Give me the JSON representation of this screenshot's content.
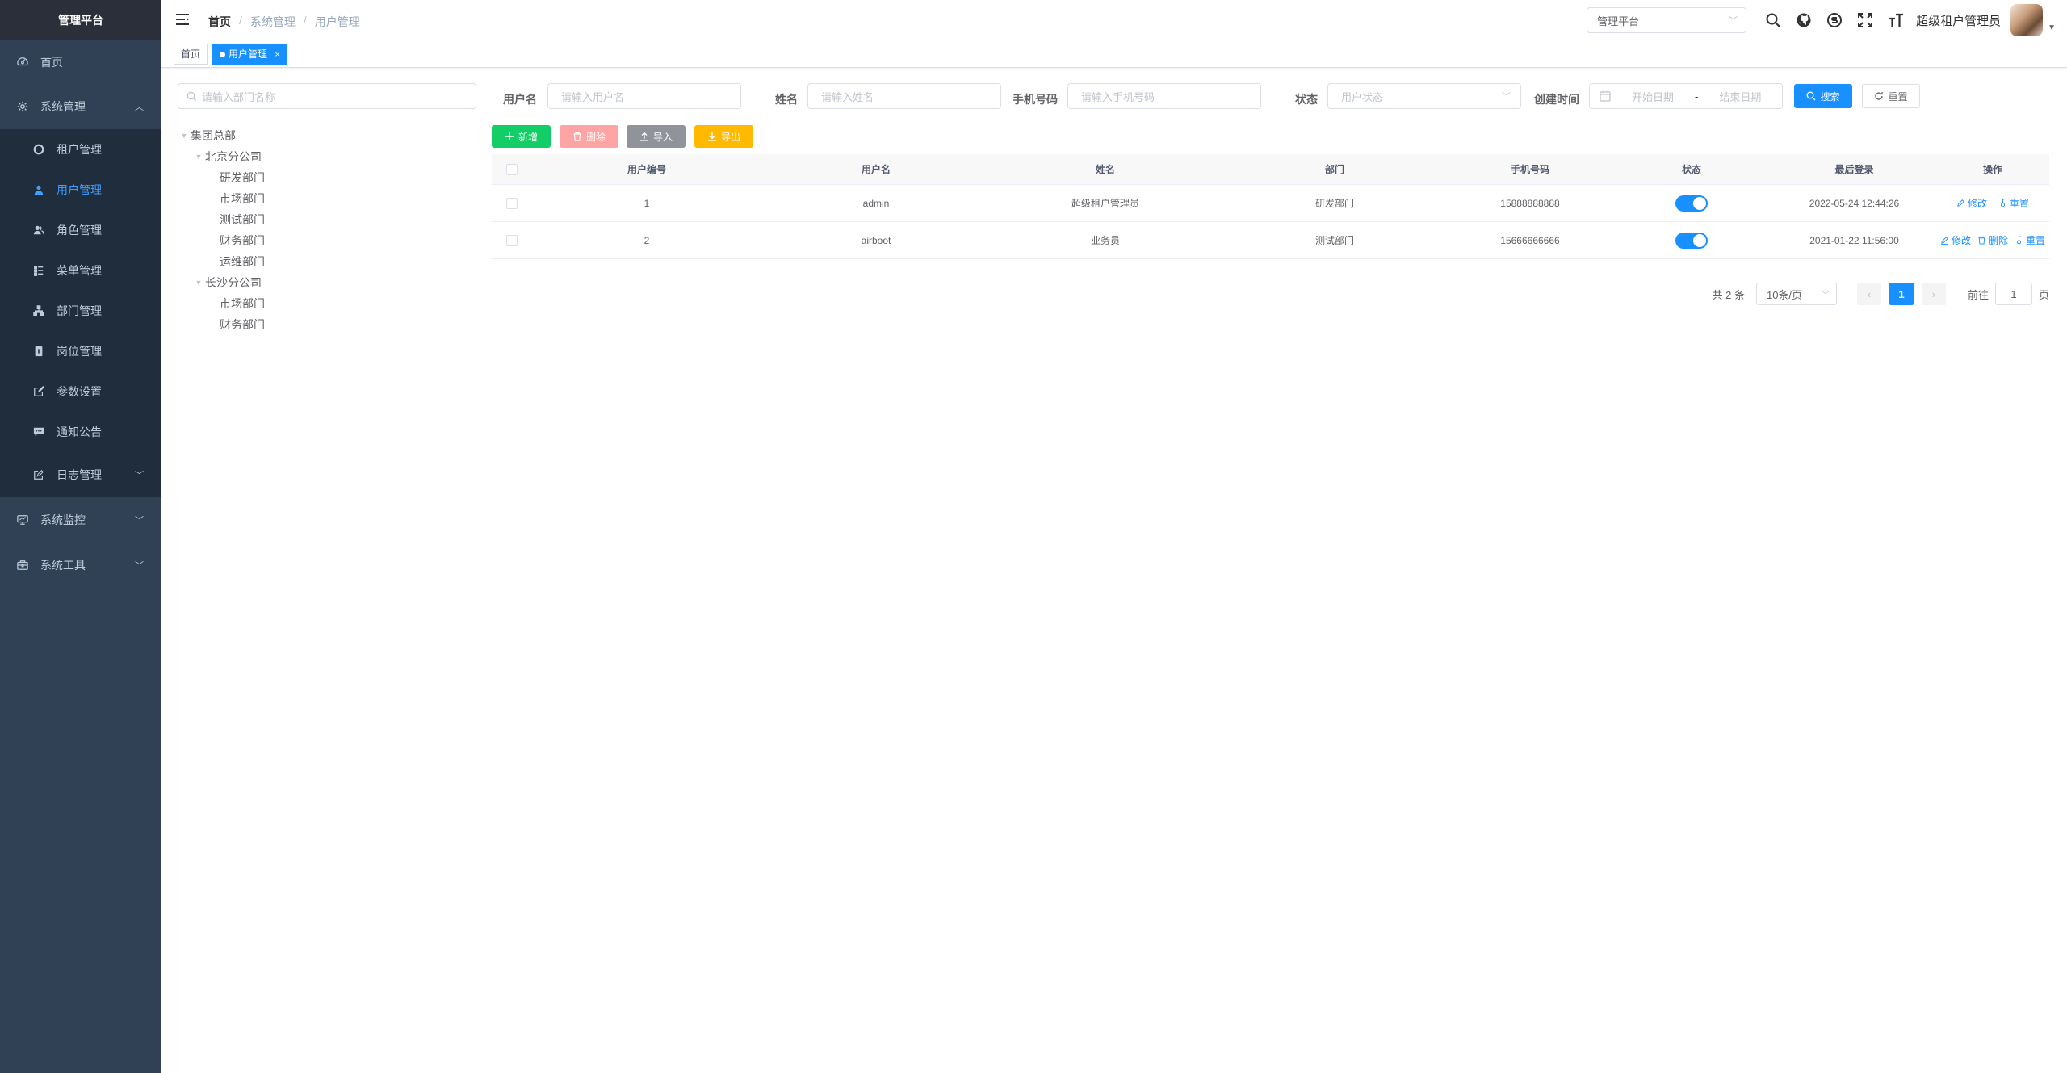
{
  "app": {
    "title": "管理平台"
  },
  "sidebar": {
    "items": [
      {
        "label": "首页",
        "icon": "dashboard-icon"
      },
      {
        "label": "系统管理",
        "icon": "gear-icon",
        "expanded": true,
        "children": [
          {
            "label": "租户管理",
            "icon": "tenant-icon"
          },
          {
            "label": "用户管理",
            "icon": "user-icon",
            "active": true
          },
          {
            "label": "角色管理",
            "icon": "peoples-icon"
          },
          {
            "label": "菜单管理",
            "icon": "tree-table-icon"
          },
          {
            "label": "部门管理",
            "icon": "tree-icon"
          },
          {
            "label": "岗位管理",
            "icon": "post-icon"
          },
          {
            "label": "参数设置",
            "icon": "edit-icon"
          },
          {
            "label": "通知公告",
            "icon": "message-icon"
          },
          {
            "label": "日志管理",
            "icon": "log-icon"
          }
        ]
      },
      {
        "label": "系统监控",
        "icon": "monitor-icon"
      },
      {
        "label": "系统工具",
        "icon": "tool-icon"
      }
    ]
  },
  "navbar": {
    "breadcrumb": [
      "首页",
      "系统管理",
      "用户管理"
    ],
    "platform_select": "管理平台",
    "user_name": "超级租户管理员"
  },
  "tags": [
    {
      "label": "首页"
    },
    {
      "label": "用户管理",
      "active": true,
      "close": "×"
    }
  ],
  "dept": {
    "search_placeholder": "请输入部门名称",
    "tree": [
      {
        "label": "集团总部",
        "level": 0,
        "expanded": true
      },
      {
        "label": "北京分公司",
        "level": 1,
        "expanded": true
      },
      {
        "label": "研发部门",
        "level": 2
      },
      {
        "label": "市场部门",
        "level": 2
      },
      {
        "label": "测试部门",
        "level": 2
      },
      {
        "label": "财务部门",
        "level": 2
      },
      {
        "label": "运维部门",
        "level": 2
      },
      {
        "label": "长沙分公司",
        "level": 1,
        "expanded": true
      },
      {
        "label": "市场部门",
        "level": 2
      },
      {
        "label": "财务部门",
        "level": 2
      }
    ]
  },
  "query": {
    "username_label": "用户名",
    "username_placeholder": "请输入用户名",
    "nickname_label": "姓名",
    "nickname_placeholder": "请输入姓名",
    "phone_label": "手机号码",
    "phone_placeholder": "请输入手机号码",
    "status_label": "状态",
    "status_placeholder": "用户状态",
    "created_label": "创建时间",
    "start_placeholder": "开始日期",
    "end_placeholder": "结束日期",
    "range_sep": "-",
    "search_btn": "搜索",
    "reset_btn": "重置"
  },
  "toolbar": {
    "add": "新增",
    "delete": "删除",
    "import": "导入",
    "export": "导出"
  },
  "table": {
    "columns": [
      "用户编号",
      "用户名",
      "姓名",
      "部门",
      "手机号码",
      "状态",
      "最后登录",
      "操作"
    ],
    "rows": [
      {
        "id": "1",
        "username": "admin",
        "nickname": "超级租户管理员",
        "dept": "研发部门",
        "phone": "15888888888",
        "status": true,
        "last_login": "2022-05-24 12:44:26",
        "actions": [
          "修改",
          "重置"
        ]
      },
      {
        "id": "2",
        "username": "airboot",
        "nickname": "业务员",
        "dept": "测试部门",
        "phone": "15666666666",
        "status": true,
        "last_login": "2021-01-22 11:56:00",
        "actions": [
          "修改",
          "删除",
          "重置"
        ]
      }
    ]
  },
  "pagination": {
    "total": "共 2 条",
    "page_size": "10条/页",
    "current": "1",
    "goto_label": "前往",
    "goto_value": "1",
    "page_unit": "页"
  },
  "colors": {
    "sidebar_bg": "#304156",
    "accent": "#1890ff",
    "success": "#13ce66",
    "warning": "#ffba00"
  }
}
